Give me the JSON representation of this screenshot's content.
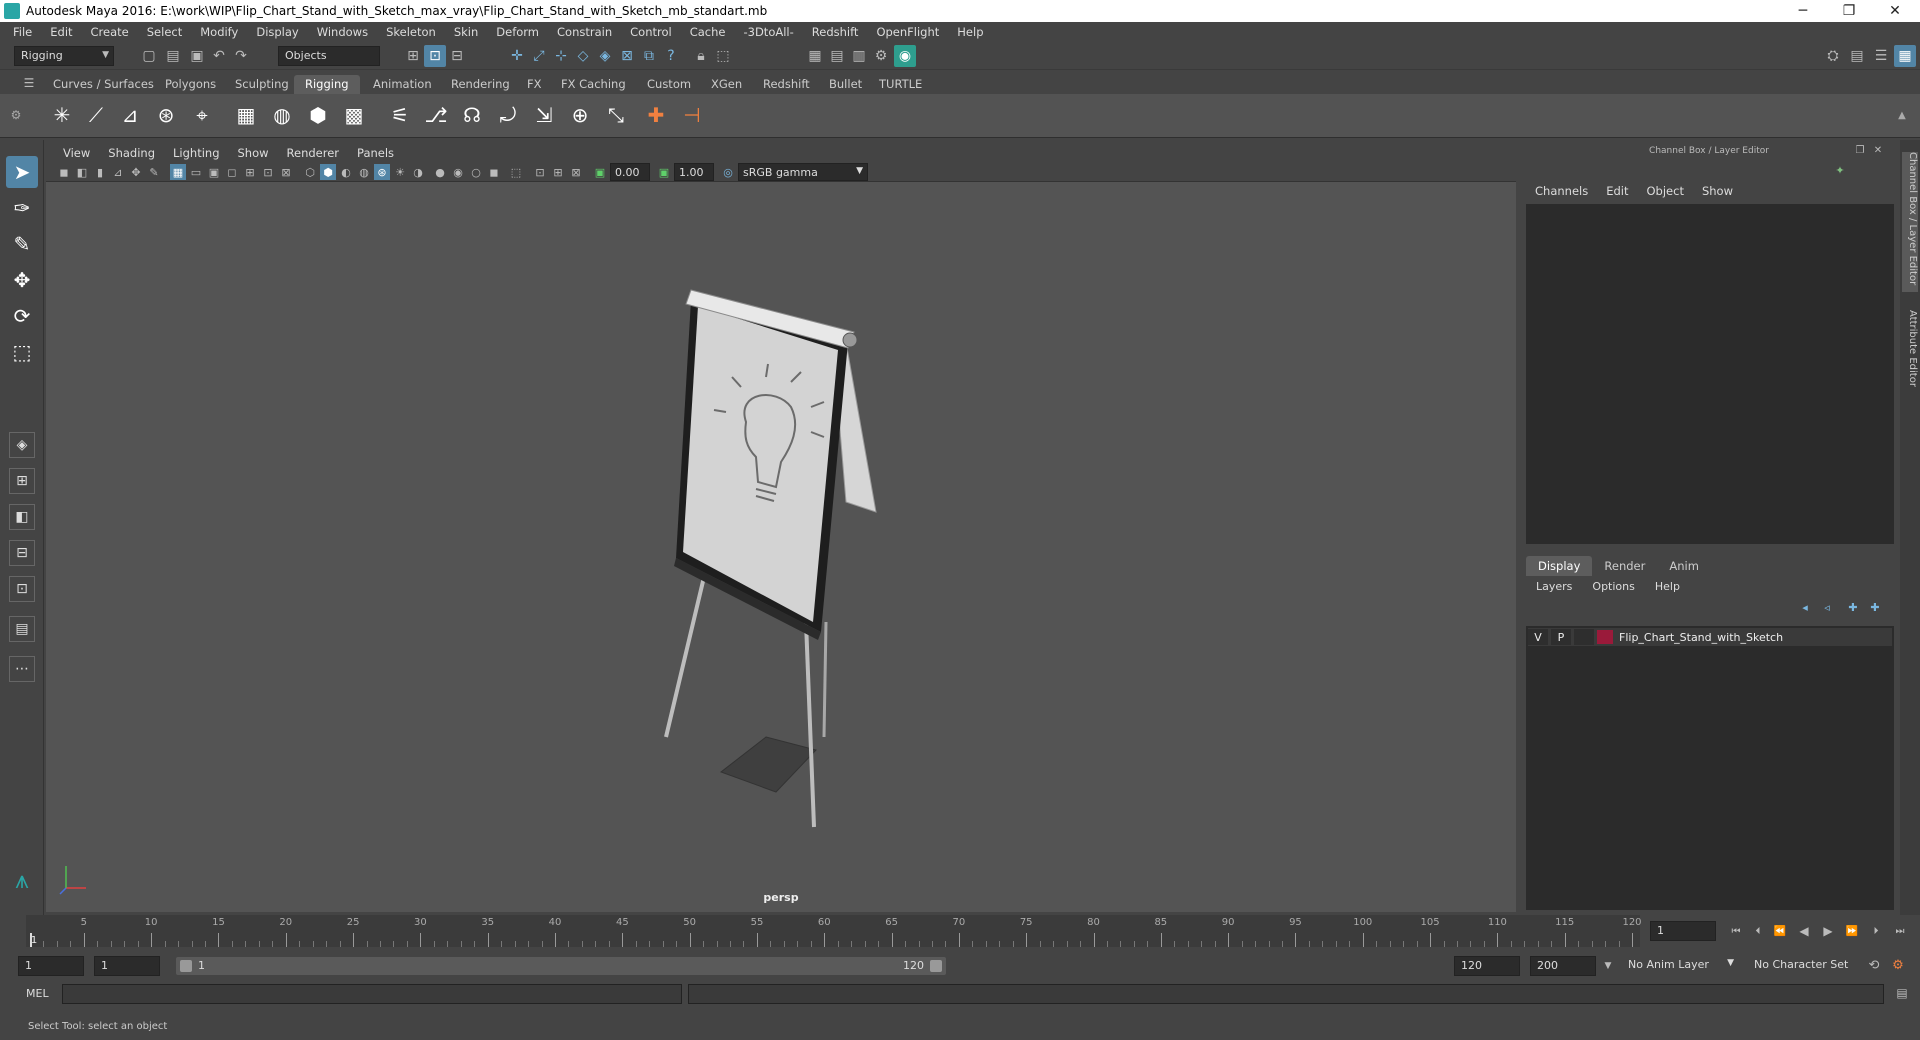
{
  "window": {
    "title": "Autodesk Maya 2016: E:\\work\\WIP\\Flip_Chart_Stand_with_Sketch_max_vray\\Flip_Chart_Stand_with_Sketch_mb_standart.mb",
    "minimize": "─",
    "restore": "❐",
    "close": "✕"
  },
  "menubar": [
    "File",
    "Edit",
    "Create",
    "Select",
    "Modify",
    "Display",
    "Windows",
    "Skeleton",
    "Skin",
    "Deform",
    "Constrain",
    "Control",
    "Cache",
    "-3DtoAll-",
    "Redshift",
    "OpenFlight",
    "Help"
  ],
  "statusline": {
    "menuset": "Rigging",
    "selection_mode": "Objects"
  },
  "shelf": {
    "tabs": [
      "Curves / Surfaces",
      "Polygons",
      "Sculpting",
      "Rigging",
      "Animation",
      "Rendering",
      "FX",
      "FX Caching",
      "Custom",
      "XGen",
      "Redshift",
      "Bullet",
      "TURTLE"
    ],
    "active_tab": "Rigging"
  },
  "viewport": {
    "menu": [
      "View",
      "Shading",
      "Lighting",
      "Show",
      "Renderer",
      "Panels"
    ],
    "exposure": "0.00",
    "gamma": "1.00",
    "color_space": "sRGB gamma",
    "camera_label": "persp"
  },
  "rightpanel": {
    "title": "Channel Box / Layer Editor",
    "channel_menu": [
      "Channels",
      "Edit",
      "Object",
      "Show"
    ],
    "layer_tabs": [
      "Display",
      "Render",
      "Anim"
    ],
    "active_layer_tab": "Display",
    "layer_menu": [
      "Layers",
      "Options",
      "Help"
    ],
    "layers": [
      {
        "v": "V",
        "p": "P",
        "name": "Flip_Chart_Stand_with_Sketch",
        "color": "#9a1a3a"
      }
    ],
    "side_tabs": [
      "Channel Box / Layer Editor",
      "Attribute Editor"
    ]
  },
  "timeline": {
    "start": 1,
    "end": 120,
    "labels": [
      "5",
      "10",
      "15",
      "20",
      "25",
      "30",
      "35",
      "40",
      "45",
      "50",
      "55",
      "60",
      "65",
      "70",
      "75",
      "80",
      "85",
      "90",
      "95",
      "100",
      "105",
      "110",
      "115",
      "120"
    ],
    "current_frame": "1",
    "first_label": "1"
  },
  "range": {
    "start_field": "1",
    "playback_start": "1",
    "slider_start": "1",
    "slider_end": "120",
    "playback_end": "120",
    "end_field": "200",
    "anim_layer": "No Anim Layer",
    "character_set": "No Character Set"
  },
  "commandline": {
    "label": "MEL"
  },
  "helpline": {
    "text": "Select Tool: select an object"
  }
}
